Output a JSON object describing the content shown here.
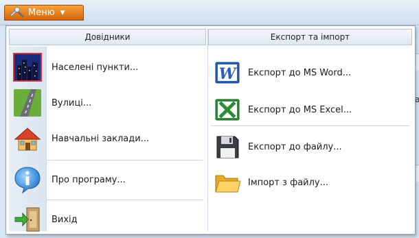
{
  "menu_button": {
    "label": "Меню"
  },
  "dropdown": {
    "left_column": {
      "header": "Довідники",
      "items": [
        {
          "label": "Населені пункти...",
          "icon": "city-night-icon"
        },
        {
          "label": "Вулиці...",
          "icon": "road-icon"
        },
        {
          "label": "Навчальні заклади...",
          "icon": "house-icon"
        },
        {
          "label": "Про програму...",
          "icon": "info-icon"
        },
        {
          "label": "Вихід",
          "icon": "exit-door-icon"
        }
      ]
    },
    "right_column": {
      "header": "Експорт та імпорт",
      "items": [
        {
          "label": "Експорт до MS Word...",
          "icon": "word-icon"
        },
        {
          "label": "Експорт до MS Excel...",
          "icon": "excel-icon"
        },
        {
          "label": "Експорт до файлу...",
          "icon": "floppy-disk-icon"
        },
        {
          "label": "Імпорт з файлу...",
          "icon": "folder-icon"
        }
      ]
    }
  },
  "background": {
    "partial_text": "а"
  },
  "colors": {
    "menu_button": "#e07a18",
    "panel_border": "#8aa1ba",
    "header_bg": "#e4ebf4"
  }
}
